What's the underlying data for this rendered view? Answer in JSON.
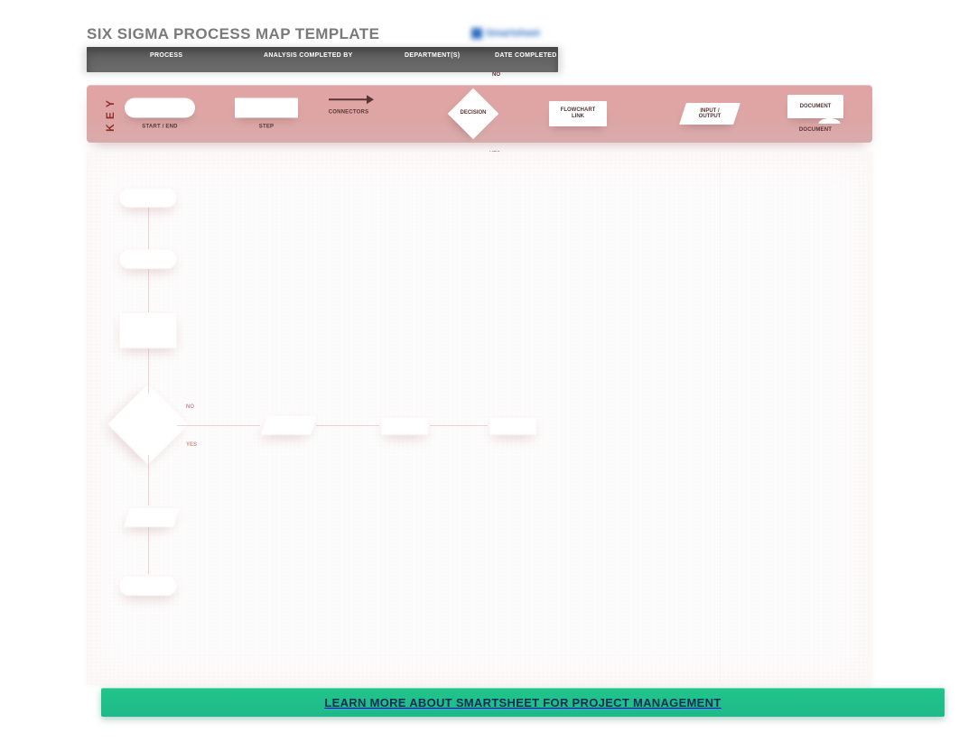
{
  "title": "SIX SIGMA PROCESS MAP TEMPLATE",
  "brand": "Smartsheet",
  "columns": {
    "process": "PROCESS",
    "analysis_by": "ANALYSIS COMPLETED BY",
    "departments": "DEPARTMENT(S)",
    "date_completed": "DATE COMPLETED"
  },
  "key": {
    "label": "KEY",
    "start_end": "START / END",
    "step": "STEP",
    "connectors": "CONNECTORS",
    "decision": "DECISION",
    "decision_no": "NO",
    "decision_yes": "YES",
    "flowchart": "FLOWCHART\nLINK",
    "io": "INPUT /\nOUTPUT",
    "document": "DOCUMENT",
    "document_shadow": "DOCUMENT"
  },
  "canvas_labels": {
    "no": "NO",
    "yes": "YES"
  },
  "cta": "LEARN MORE ABOUT SMARTSHEET FOR PROJECT MANAGEMENT"
}
